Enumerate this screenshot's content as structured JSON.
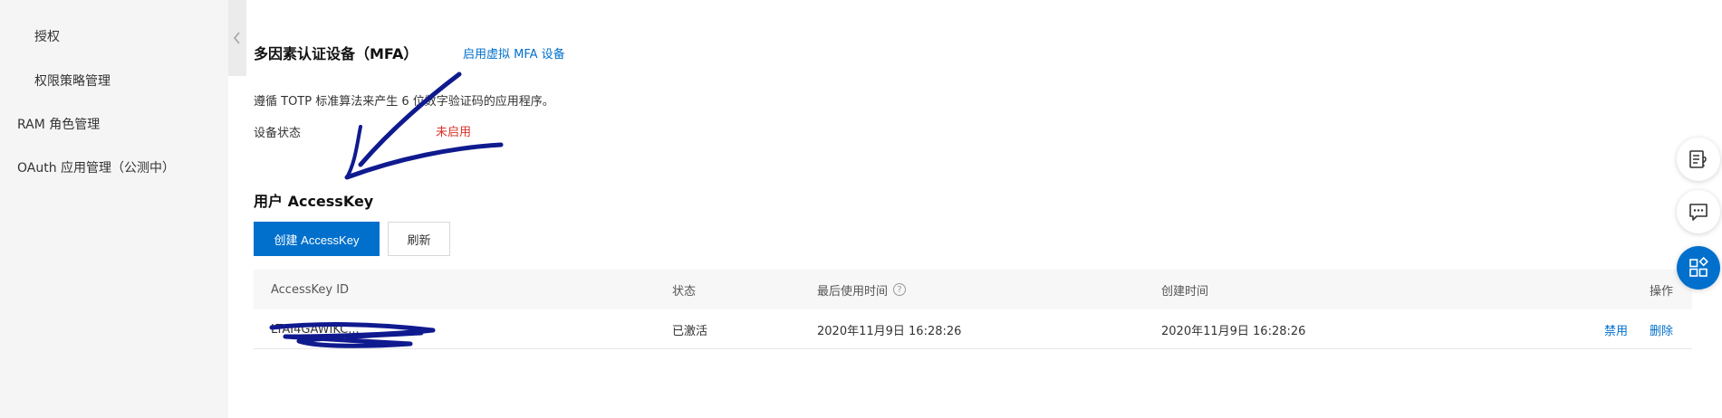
{
  "sidebar": {
    "items": [
      {
        "label": "授权"
      },
      {
        "label": "权限策略管理"
      },
      {
        "label": "RAM 角色管理"
      },
      {
        "label": "OAuth 应用管理（公测中）"
      }
    ]
  },
  "mfa": {
    "title": "多因素认证设备（MFA）",
    "enable_link": "启用虚拟 MFA 设备",
    "description": "遵循 TOTP 标准算法来产生 6 位数字验证码的应用程序。",
    "status_label": "设备状态",
    "status_value": "未启用"
  },
  "accesskey": {
    "title": "用户 AccessKey",
    "create_button": "创建 AccessKey",
    "refresh_button": "刷新",
    "columns": [
      "AccessKey ID",
      "状态",
      "最后使用时间",
      "创建时间",
      "操作"
    ],
    "help_icon": "?",
    "rows": [
      {
        "id": "LTAI4GAWIKC...",
        "status": "已激活",
        "last_used": "2020年11月9日 16:28:26",
        "created": "2020年11月9日 16:28:26",
        "actions": [
          "禁用",
          "删除"
        ]
      }
    ]
  },
  "colors": {
    "primary": "#0070cc",
    "danger": "#d93026",
    "annotation": "#101a8f"
  }
}
